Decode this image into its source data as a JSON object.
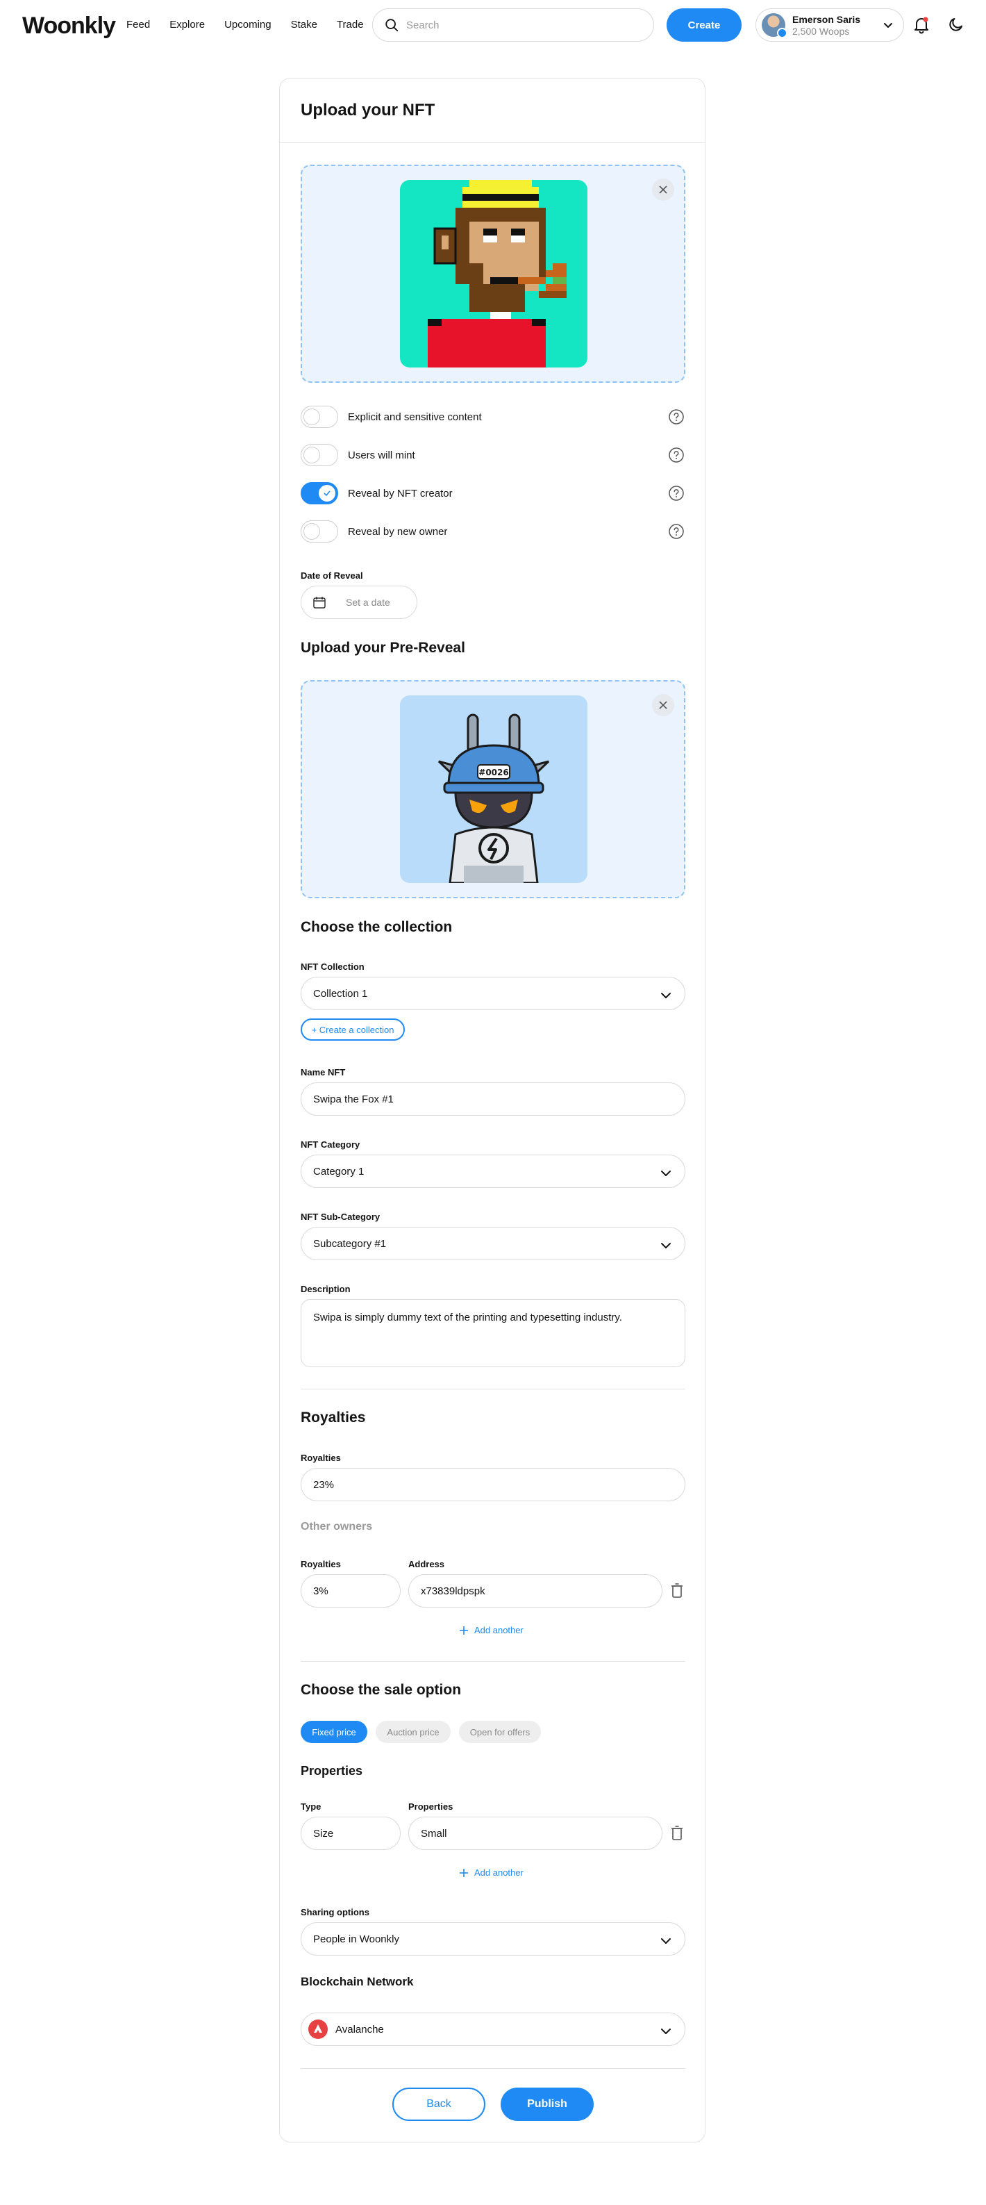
{
  "header": {
    "logo": "Woonkly",
    "nav": [
      "Feed",
      "Explore",
      "Upcoming",
      "Stake",
      "Trade"
    ],
    "search_placeholder": "Search",
    "create_label": "Create",
    "user": {
      "name": "Emerson Saris",
      "balance": "2,500 Woops"
    }
  },
  "upload": {
    "title": "Upload your NFT",
    "toggles": [
      {
        "label": "Explicit and sensitive content",
        "on": false
      },
      {
        "label": "Users will mint",
        "on": false
      },
      {
        "label": "Reveal by NFT creator",
        "on": true
      },
      {
        "label": "Reveal by new owner",
        "on": false
      }
    ],
    "date_label": "Date of Reveal",
    "date_placeholder": "Set a date",
    "pre_reveal_title": "Upload your Pre-Reveal",
    "pre_reveal_tag": "#0026"
  },
  "collection": {
    "title": "Choose the collection",
    "collection_label": "NFT Collection",
    "collection_value": "Collection 1",
    "create_collection": "+ Create a collection",
    "name_label": "Name NFT",
    "name_value": "Swipa the Fox #1",
    "category_label": "NFT Category",
    "category_value": "Category 1",
    "subcategory_label": "NFT Sub-Category",
    "subcategory_value": "Subcategory #1",
    "description_label": "Description",
    "description_value": "Swipa is simply dummy text of the printing and typesetting industry."
  },
  "royalties": {
    "title": "Royalties",
    "royalties_label": "Royalties",
    "royalties_value": "23%",
    "other_owners": "Other owners",
    "owner_royalties_label": "Royalties",
    "address_label": "Address",
    "owner_royalties_value": "3%",
    "address_value": "x73839ldpspk",
    "add_another": "Add another"
  },
  "sale": {
    "title": "Choose the sale option",
    "options": [
      "Fixed price",
      "Auction price",
      "Open for offers"
    ],
    "active_option": "Fixed price",
    "properties_title": "Properties",
    "type_label": "Type",
    "properties_label": "Properties",
    "type_value": "Size",
    "properties_value": "Small",
    "add_another": "Add another",
    "sharing_label": "Sharing options",
    "sharing_value": "People in Woonkly",
    "blockchain_title": "Blockchain Network",
    "blockchain_value": "Avalanche"
  },
  "footer": {
    "back_label": "Back",
    "publish_label": "Publish"
  },
  "colors": {
    "accent": "#1f8af4",
    "drop_bg": "#eaf3fe",
    "border": "#d9d9d9"
  }
}
